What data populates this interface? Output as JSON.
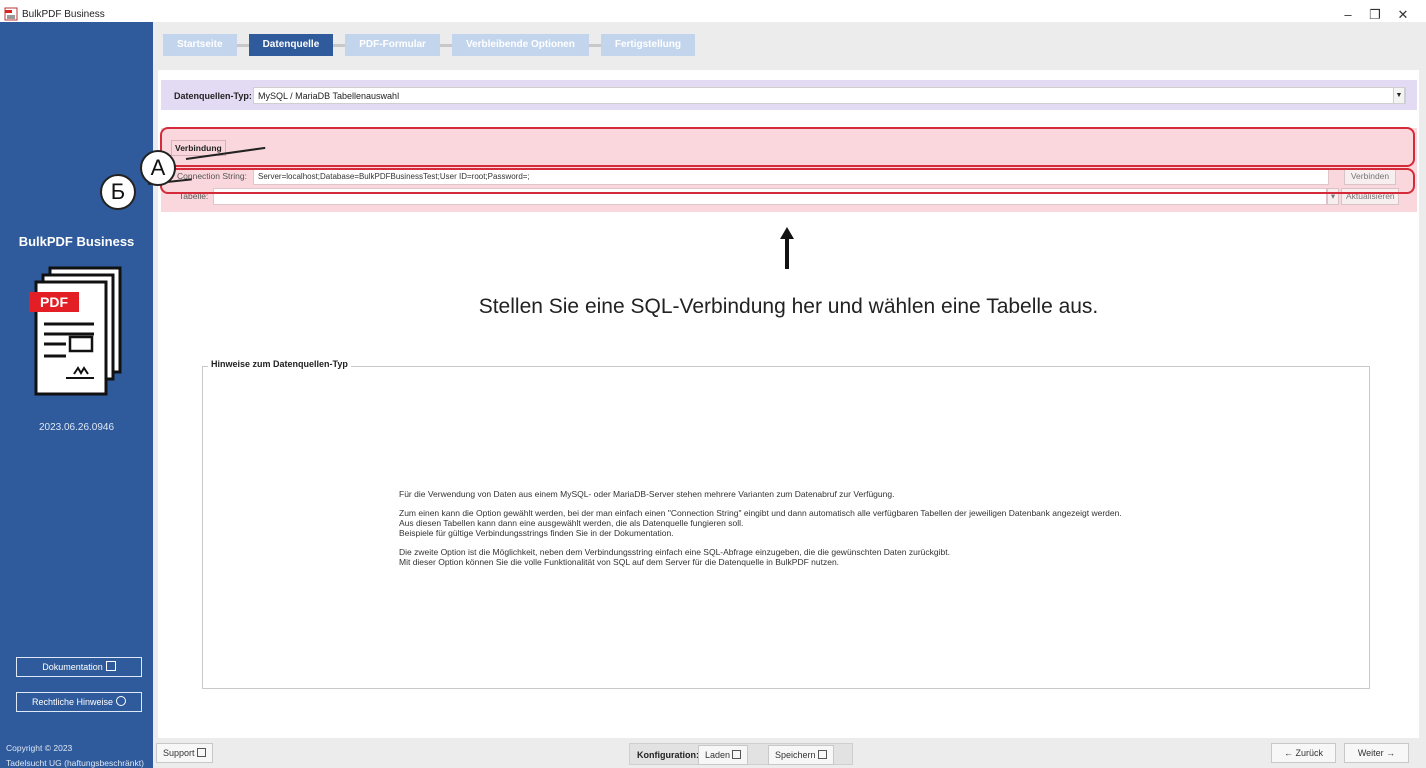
{
  "window": {
    "title": "BulkPDF Business",
    "minimize": "–",
    "maximize": "❐",
    "close": "✕"
  },
  "sidebar": {
    "brand": "BulkPDF Business",
    "logo_text": "PDF",
    "version": "2023.06.26.0946",
    "docs_button": "Dokumentation",
    "legal_button": "Rechtliche Hinweise",
    "copyright_line1": "Copyright © 2023",
    "copyright_line2": "Tadelsucht UG (haftungsbeschränkt)"
  },
  "steps": [
    {
      "label": "Startseite"
    },
    {
      "label": "Datenquelle"
    },
    {
      "label": "PDF-Formular"
    },
    {
      "label": "Verbleibende Optionen"
    },
    {
      "label": "Fertigstellung"
    }
  ],
  "active_step": "Datenquelle",
  "datasource": {
    "type_label": "Datenquellen-Typ:",
    "type_value": "MySQL / MariaDB Tabellenauswahl"
  },
  "connection": {
    "group_label": "Verbindung",
    "connection_label": "Connection String:",
    "connection_value": "Server=localhost;Database=BulkPDFBusinessTest;User ID=root;Password=;",
    "connect_button": "Verbinden",
    "table_label": "Tabelle:",
    "table_value": "",
    "refresh_button": "Aktualisieren"
  },
  "callouts": {
    "a": "A",
    "b": "Б"
  },
  "headline": "Stellen Sie eine SQL-Verbindung her und wählen eine Tabelle aus.",
  "hints": {
    "legend": "Hinweise zum Datenquellen-Typ",
    "p1": "Für die Verwendung von Daten aus einem MySQL- oder MariaDB-Server stehen mehrere Varianten zum Datenabruf zur Verfügung.",
    "p2_l1": "Zum einen kann die Option gewählt werden, bei der man einfach einen \"Connection String\" eingibt und dann automatisch alle verfügbaren Tabellen der jeweiligen Datenbank angezeigt werden.",
    "p2_l2": "Aus diesen Tabellen kann dann eine ausgewählt werden, die als Datenquelle fungieren soll.",
    "p2_l3": "Beispiele für gültige Verbindungsstrings finden Sie in der Dokumentation.",
    "p3_l1": "Die zweite Option ist die Möglichkeit, neben dem Verbindungsstring einfach eine SQL-Abfrage einzugeben, die die gewünschten Daten zurückgibt.",
    "p3_l2": "Mit dieser Option können Sie die volle Funktionalität von SQL auf dem Server für die Datenquelle in BulkPDF nutzen."
  },
  "footer": {
    "support": "Support",
    "config_label": "Konfiguration:",
    "load": "Laden",
    "save": "Speichern",
    "back": "← Zurück",
    "next": "Weiter →"
  },
  "colors": {
    "sidebar": "#2f5a9b",
    "step_active": "#2f5a9b",
    "step_inactive": "#c3d5ec",
    "highlight": "#d42a3a",
    "type_row": "#e3daf4",
    "connection_box": "#f9d7dc"
  }
}
